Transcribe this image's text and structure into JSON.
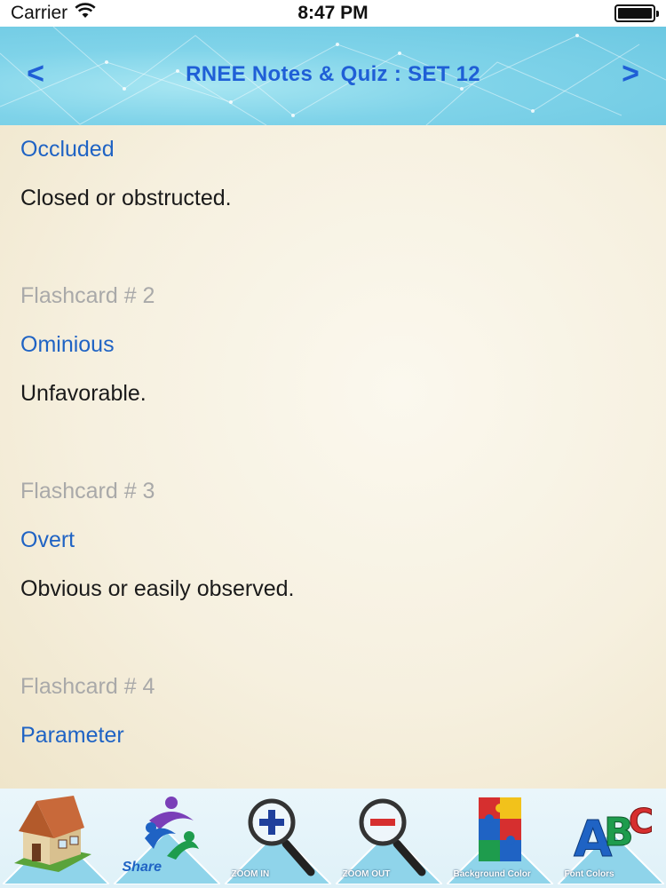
{
  "status_bar": {
    "carrier": "Carrier",
    "time": "8:47 PM",
    "wifi_icon": "wifi-icon",
    "battery_level": 1.0
  },
  "nav": {
    "title": "RNEE Notes & Quiz : SET 12",
    "prev_label": "<",
    "next_label": ">"
  },
  "cards": [
    {
      "label": "",
      "term": "Occluded",
      "definition": "Closed or obstructed."
    },
    {
      "label": "Flashcard # 2",
      "term": "Ominious",
      "definition": "Unfavorable."
    },
    {
      "label": "Flashcard # 3",
      "term": "Overt",
      "definition": "Obvious or easily observed."
    },
    {
      "label": "Flashcard # 4",
      "term": "Parameter",
      "definition": ""
    }
  ],
  "toolbar": {
    "items": [
      {
        "name": "home",
        "icon": "house-icon",
        "label": ""
      },
      {
        "name": "share",
        "icon": "share-icon",
        "label": "Share"
      },
      {
        "name": "zoom-in",
        "icon": "zoom-in-icon",
        "label": "ZOOM IN"
      },
      {
        "name": "zoom-out",
        "icon": "zoom-out-icon",
        "label": "ZOOM OUT"
      },
      {
        "name": "background-color",
        "icon": "puzzle-icon",
        "label": "Background Color"
      },
      {
        "name": "font-color",
        "icon": "abc-blocks-icon",
        "label": "Font Colors"
      }
    ]
  },
  "colors": {
    "term": "#1f63c4",
    "label": "#a9a9a9",
    "title": "#1f5fd6"
  }
}
